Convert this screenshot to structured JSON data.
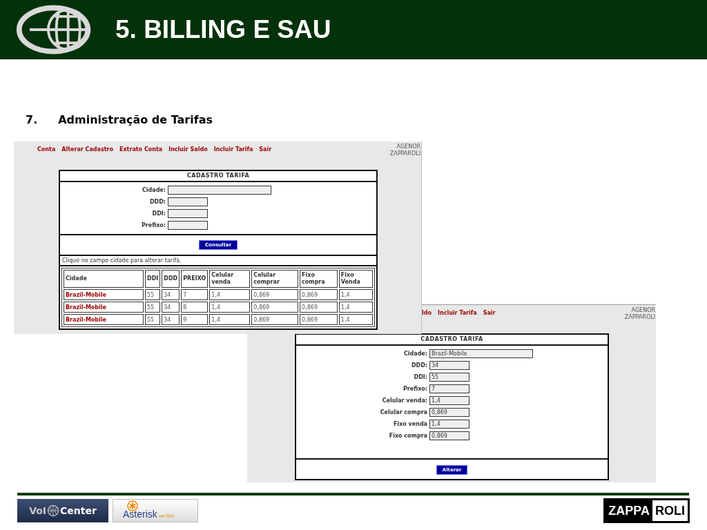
{
  "header": {
    "title": "5. BILLING E SAU"
  },
  "section": {
    "number": "7.",
    "title": "Administração de Tarifas"
  },
  "screenshot_1": {
    "nav": [
      "Conta",
      "Alterar Cadastro",
      "Extrato Conta",
      "Incluir Saldo",
      "Incluir Tarifa",
      "Sair"
    ],
    "user": [
      "AGENOR",
      "ZAPPAROLI"
    ],
    "form_title": "CADASTRO TARIFA",
    "fields": [
      {
        "label": "Cidade:",
        "wide": true
      },
      {
        "label": "DDD:",
        "wide": false
      },
      {
        "label": "DDI:",
        "wide": false
      },
      {
        "label": "Prefixo:",
        "wide": false
      }
    ],
    "button": "Consultar",
    "hint": "Clique no campo cidade para alterar tarifa.",
    "table": {
      "columns": [
        "Cidade",
        "DDI",
        "DDD",
        "PREIXO",
        "Celular venda",
        "Celular comprar",
        "Fixo compra",
        "Fixo Venda"
      ],
      "rows": [
        [
          "Brazil-Mobile",
          "55",
          "34",
          "7",
          "1,4",
          "0,869",
          "0,869",
          "1,4"
        ],
        [
          "Brazil-Mobile",
          "55",
          "34",
          "8",
          "1,4",
          "0,869",
          "0,869",
          "1,4"
        ],
        [
          "Brazil-Mobile",
          "55",
          "34",
          "9",
          "1,4",
          "0,869",
          "0,869",
          "1,4"
        ]
      ]
    }
  },
  "screenshot_2": {
    "nav": [
      "ldo",
      "Incluir Tarifa",
      "Sair"
    ],
    "user": [
      "AGENOR",
      "ZAPPAROLI"
    ],
    "form_title": "CADASTRO TARIFA",
    "fields": [
      {
        "label": "Cidade:",
        "value": "Brazil-Mobile",
        "wide": true
      },
      {
        "label": "DDD:",
        "value": "34",
        "wide": false
      },
      {
        "label": "DDI:",
        "value": "55",
        "wide": false
      },
      {
        "label": "Prefixo:",
        "value": "7",
        "wide": false
      },
      {
        "label": "Celular venda:",
        "value": "1,4",
        "wide": false
      },
      {
        "label": "Celular compra",
        "value": "0,869",
        "wide": false
      },
      {
        "label": "Fixo venda",
        "value": "1,4",
        "wide": false
      },
      {
        "label": "Fixo compra",
        "value": "0,869",
        "wide": false
      }
    ],
    "button": "Alterar"
  },
  "footer": {
    "voip_logo": [
      "VoI",
      "Center"
    ],
    "asterisk_logo": [
      "Asterisk",
      "on-line"
    ],
    "zapparoli_logo": [
      "ZAPPA",
      "ROLI"
    ]
  }
}
